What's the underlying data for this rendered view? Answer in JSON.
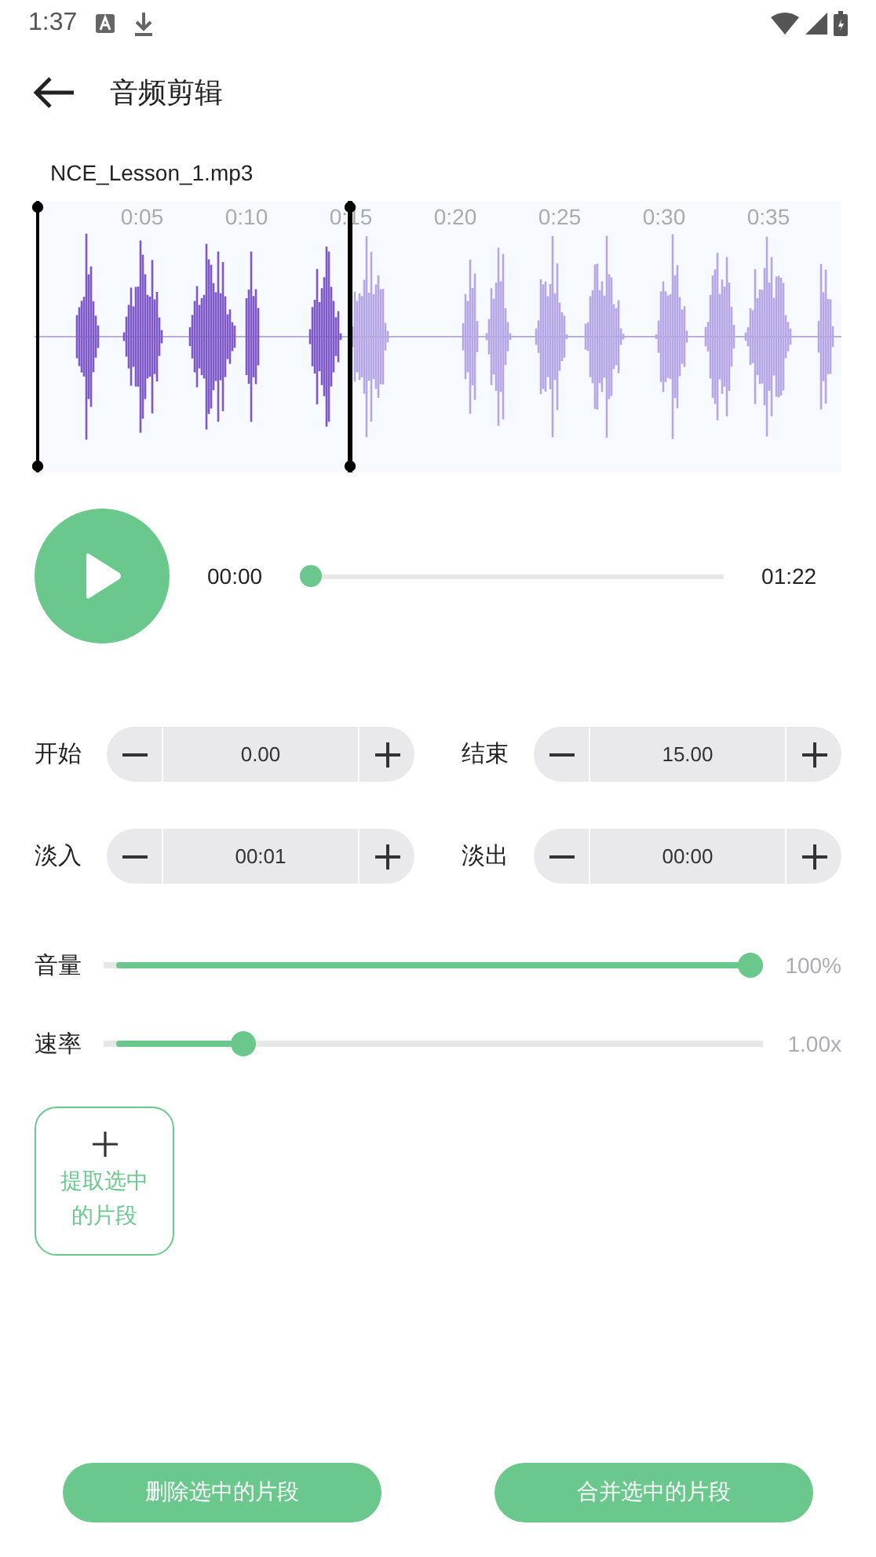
{
  "status_bar": {
    "time": "1:37"
  },
  "header": {
    "title": "音频剪辑"
  },
  "file_name": "NCE_Lesson_1.mp3",
  "waveform": {
    "ticks": [
      "0:05",
      "0:10",
      "0:15",
      "0:20",
      "0:25",
      "0:30",
      "0:35"
    ],
    "handles": [
      {
        "level": 0
      },
      {
        "level": 0.39
      }
    ]
  },
  "player": {
    "playing": false,
    "current": "00:00",
    "total": "01:22",
    "seek": {
      "level": 0
    }
  },
  "steppers": [
    {
      "label": "开始",
      "value": "0.00"
    },
    {
      "label": "结束",
      "value": "15.00"
    },
    {
      "label": "淡入",
      "value": "00:01"
    },
    {
      "label": "淡出",
      "value": "00:00"
    }
  ],
  "sliders": [
    {
      "label": "音量",
      "level": 1,
      "reading": "100%"
    },
    {
      "label": "速率",
      "level": 0.2,
      "reading": "1.00x"
    }
  ],
  "extract_button": {
    "label": "提取选中的片段"
  },
  "actions": [
    "删除选中的片段",
    "合并选中的片段"
  ]
}
